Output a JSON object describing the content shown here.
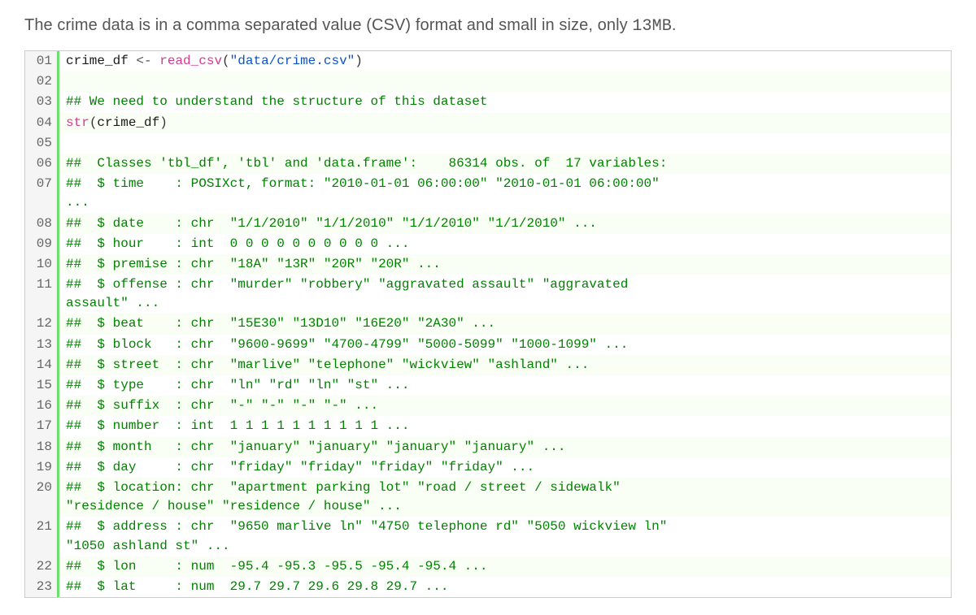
{
  "intro": {
    "prefix": "The crime data is in a comma separated value (CSV) format and small in size, only ",
    "size": "13MB",
    "suffix": "."
  },
  "code": {
    "l01": {
      "var": "crime_df ",
      "assign": "<- ",
      "fn": "read_csv",
      "paren_open": "(",
      "str": "\"data/crime.csv\"",
      "paren_close": ")"
    },
    "l02": "",
    "l03": "## We need to understand the structure of this dataset",
    "l04": {
      "fn": "str",
      "paren_open": "(",
      "arg": "crime_df",
      "paren_close": ")"
    },
    "l05": "",
    "l06": "##  Classes 'tbl_df', 'tbl' and 'data.frame':    86314 obs. of  17 variables:",
    "l07a": "##  $ time    : POSIXct, format: \"2010-01-01 06:00:00\" \"2010-01-01 06:00:00\"",
    "l07b": "...",
    "l08": "##  $ date    : chr  \"1/1/2010\" \"1/1/2010\" \"1/1/2010\" \"1/1/2010\" ...",
    "l09": "##  $ hour    : int  0 0 0 0 0 0 0 0 0 0 ...",
    "l10": "##  $ premise : chr  \"18A\" \"13R\" \"20R\" \"20R\" ...",
    "l11a": "##  $ offense : chr  \"murder\" \"robbery\" \"aggravated assault\" \"aggravated",
    "l11b": "assault\" ...",
    "l12": "##  $ beat    : chr  \"15E30\" \"13D10\" \"16E20\" \"2A30\" ...",
    "l13": "##  $ block   : chr  \"9600-9699\" \"4700-4799\" \"5000-5099\" \"1000-1099\" ...",
    "l14": "##  $ street  : chr  \"marlive\" \"telephone\" \"wickview\" \"ashland\" ...",
    "l15": "##  $ type    : chr  \"ln\" \"rd\" \"ln\" \"st\" ...",
    "l16": "##  $ suffix  : chr  \"-\" \"-\" \"-\" \"-\" ...",
    "l17": "##  $ number  : int  1 1 1 1 1 1 1 1 1 1 ...",
    "l18": "##  $ month   : chr  \"january\" \"january\" \"january\" \"january\" ...",
    "l19": "##  $ day     : chr  \"friday\" \"friday\" \"friday\" \"friday\" ...",
    "l20a": "##  $ location: chr  \"apartment parking lot\" \"road / street / sidewalk\"",
    "l20b": "\"residence / house\" \"residence / house\" ...",
    "l21a": "##  $ address : chr  \"9650 marlive ln\" \"4750 telephone rd\" \"5050 wickview ln\"",
    "l21b": "\"1050 ashland st\" ...",
    "l22": "##  $ lon     : num  -95.4 -95.3 -95.5 -95.4 -95.4 ...",
    "l23": "##  $ lat     : num  29.7 29.7 29.6 29.8 29.7 ..."
  },
  "gutter": {
    "g01": "01",
    "g02": "02",
    "g03": "03",
    "g04": "04",
    "g05": "05",
    "g06": "06",
    "g07": "07",
    "g08": "08",
    "g09": "09",
    "g10": "10",
    "g11": "11",
    "g12": "12",
    "g13": "13",
    "g14": "14",
    "g15": "15",
    "g16": "16",
    "g17": "17",
    "g18": "18",
    "g19": "19",
    "g20": "20",
    "g21": "21",
    "g22": "22",
    "g23": "23"
  }
}
